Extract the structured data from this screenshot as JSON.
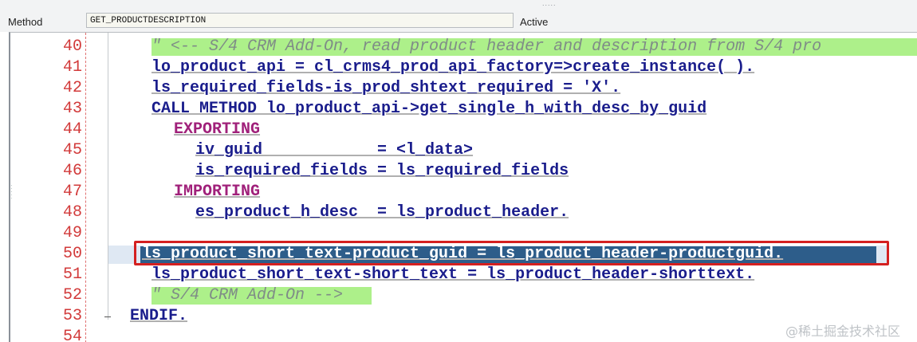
{
  "header": {
    "grip": ".....",
    "method_label": "Method",
    "method_value": "GET_PRODUCTDESCRIPTION",
    "status": "Active"
  },
  "editor": {
    "lines": [
      {
        "num": "40",
        "text": "\" <-- S/4 CRM Add-On, read product header and description from S/4 pro"
      },
      {
        "num": "41",
        "text": "lo_product_api = cl_crms4_prod_api_factory=>create_instance( )."
      },
      {
        "num": "42",
        "text": "ls_required_fields-is_prod_shtext_required = 'X'."
      },
      {
        "num": "43",
        "text": "CALL METHOD lo_product_api->get_single_h_with_desc_by_guid"
      },
      {
        "num": "44",
        "text": "EXPORTING"
      },
      {
        "num": "45",
        "text": "iv_guid            = <l_data>"
      },
      {
        "num": "46",
        "text": "is_required_fields = ls_required_fields"
      },
      {
        "num": "47",
        "text": "IMPORTING"
      },
      {
        "num": "48",
        "text": "es_product_h_desc  = ls_product_header."
      },
      {
        "num": "49",
        "text": ""
      },
      {
        "num": "50",
        "text": "ls_product_short_text-product_guid = ls_product_header-productguid."
      },
      {
        "num": "51",
        "text": "ls_product_short_text-short_text = ls_product_header-shorttext."
      },
      {
        "num": "52",
        "text": "\" S/4 CRM Add-On -->"
      },
      {
        "num": "53",
        "text": "ENDIF."
      },
      {
        "num": "54",
        "text": ""
      }
    ]
  },
  "watermark": "@稀土掘金技术社区",
  "colors": {
    "keyword": "#a0207a",
    "identifier": "#1a1d8c",
    "comment_bg": "#adf08a",
    "selection": "#2d5d8a",
    "highlight_border": "#d42020",
    "line_number": "#d23a3a"
  }
}
